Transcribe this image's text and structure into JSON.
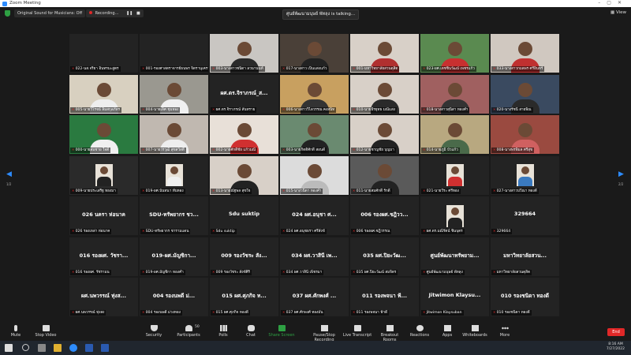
{
  "window": {
    "title": "Zoom Meeting"
  },
  "topbar": {
    "original_sound": "Original Sound for Musicians: Off",
    "recording": "Recording...",
    "speaker": "ศูนย์พัฒนามนุษย์ พัทลุง is talking...",
    "view": "View"
  },
  "participants": [
    {
      "name": "022-นส.จริยา อินทรมะสูตร",
      "big": "",
      "photo": "blank"
    },
    {
      "name": "001-รองศาสตราจารย์ธนพร จิตรานุเคราะห์",
      "big": "",
      "photo": "blank"
    },
    {
      "name": "003-นางสาวชนิดา ลวนานนท์",
      "big": "",
      "photo": "person",
      "bg": "#c9c6c2",
      "shirt": "#2a2a2a"
    },
    {
      "name": "017-นางสาว เป็นแสงแก้ว",
      "big": "",
      "photo": "person",
      "bg": "#4a4038",
      "shirt": "#222"
    },
    {
      "name": "001-มหาวิทยาลัยสวนดุสิต",
      "big": "",
      "photo": "person",
      "bg": "#d8d0c8",
      "shirt": "#b03030"
    },
    {
      "name": "023-ผศ.เดชชินวัฒน์ เพชรแก้ว",
      "big": "",
      "photo": "person",
      "bg": "#5a8a50",
      "shirt": "#c83030"
    },
    {
      "name": "033-นางสาวกมลพร ศรีอินทร์",
      "big": "",
      "photo": "person",
      "bg": "#d0c8c0",
      "shirt": "#c03030"
    },
    {
      "name": "005-นายวิโรจน์ ลิ้มสกุลภัทร",
      "big": "",
      "photo": "person",
      "bg": "#d8d0c0",
      "shirt": "#eeeeee"
    },
    {
      "name": "004-นายเลิศ ชุมทอง",
      "big": "",
      "photo": "person",
      "bg": "#9a9890",
      "shirt": "#f0f0f0"
    },
    {
      "name": "ผศ.ดร.จิราภรณ์ สันทราย",
      "big": "ผศ.ดร.จิราภรณ์_ส...",
      "photo": "name"
    },
    {
      "name": "006-นางสาววิไลวรรณ คงสนิท",
      "big": "",
      "photo": "person",
      "bg": "#c8a060",
      "shirt": "#333"
    },
    {
      "name": "010-นายธีรยุทธ มณีแสง",
      "big": "",
      "photo": "person",
      "bg": "#d8d0c8",
      "shirt": "#2a2a2a"
    },
    {
      "name": "018-นางสาวสุนิสา ทองคำ",
      "big": "",
      "photo": "person",
      "bg": "#a06060",
      "shirt": "#333"
    },
    {
      "name": "020-นางรัชนี สายพิณ",
      "big": "",
      "photo": "person",
      "bg": "#3a4a60",
      "shirt": "#2a2a2a"
    },
    {
      "name": "000-นายสมชาย ใจดี",
      "big": "",
      "photo": "person",
      "bg": "#2a7a40",
      "shirt": "#f0f0f0"
    },
    {
      "name": "007-นายวรวุฒิ สุขสวัสดิ์",
      "big": "",
      "photo": "person",
      "bg": "#c0b8b0",
      "shirt": "#eeeeee"
    },
    {
      "name": "002-นายศักดิ์ชัย แก้วมณี",
      "big": "",
      "photo": "person",
      "bg": "#e8e0d8",
      "shirt": "#d03030"
    },
    {
      "name": "003-นายกิตติศักดิ์ สอนดี",
      "big": "",
      "photo": "person",
      "bg": "#6a8a70",
      "shirt": "#222"
    },
    {
      "name": "012-นายชาญชัย บุญมา",
      "big": "",
      "photo": "person",
      "bg": "#d8d0c8",
      "shirt": "#222"
    },
    {
      "name": "014-นายภูมิ บัวแก้ว",
      "big": "",
      "photo": "person",
      "bg": "#b8a880",
      "shirt": "#4a6a4a"
    },
    {
      "name": "008-นางพรพิมล ศรีสุข",
      "big": "",
      "photo": "person",
      "bg": "#9a4a40",
      "shirt": "#d06060"
    },
    {
      "name": "009-นายประเสริฐ ทองมา",
      "big": "",
      "photo": "portrait",
      "bg": "#2a2a2a",
      "shirt": "#222"
    },
    {
      "name": "019-ผศ.นันทนา ทับทอง",
      "big": "",
      "photo": "portrait",
      "bg": "#232323",
      "shirt": "#f0f0f0"
    },
    {
      "name": "013-นายณัฐพล สุขใจ",
      "big": "",
      "photo": "person",
      "bg": "#d8d0c8",
      "shirt": "#222"
    },
    {
      "name": "015-นางวนิดา ทองคำ",
      "big": "",
      "photo": "person",
      "bg": "#dcdcdc",
      "shirt": "#bbbbbb"
    },
    {
      "name": "011-นายสมศักดิ์ รักดี",
      "big": "",
      "photo": "person",
      "bg": "#5a5a5a",
      "shirt": "#222"
    },
    {
      "name": "021-นายวีระ ศรีทอง",
      "big": "",
      "photo": "portrait",
      "bg": "#232323",
      "shirt": "#d03030"
    },
    {
      "name": "027-นางสาวปวีณา ทองดี",
      "big": "",
      "photo": "portrait",
      "bg": "#232323",
      "shirt": "#3a7ac0"
    },
    {
      "name": "026 รองเหล่า ห่อนาค",
      "big": "026 นครา ห่อนาค",
      "photo": "name"
    },
    {
      "name": "SDU-ทรัพยากร ชารามแดน",
      "big": "SDU-ทรัพยากร ชว...",
      "photo": "name"
    },
    {
      "name": "Sdu suktip",
      "big": "Sdu suktip",
      "photo": "name"
    },
    {
      "name": "024 ผศ.อนุชธรา ศรีสังข์",
      "big": "024 ผศ.อนุชา ศ...",
      "photo": "name"
    },
    {
      "name": "006 รองผศ.ชฎิวรรณ",
      "big": "006 รองผศ.ชฎิวว...",
      "photo": "name"
    },
    {
      "name": "ผศ.ดร.มณีรัตน์ ชินบุตร",
      "big": "",
      "photo": "portrait",
      "bg": "#232323",
      "shirt": "#222"
    },
    {
      "name": "329664",
      "big": "329664",
      "photo": "name"
    },
    {
      "name": "016 รองผศ. รัชรามน",
      "big": "016 รองผศ. วัชรา...",
      "photo": "name"
    },
    {
      "name": "019-ผศ.มัญชิกา ทองคำ",
      "big": "019-ผศ.มัญชิกา...",
      "photo": "name"
    },
    {
      "name": "009 รองวัชระ สังข์ศิริ",
      "big": "009 รองวัชระ สัง...",
      "photo": "name"
    },
    {
      "name": "034 ผศ.วาสินี เพ็ชรมา",
      "big": "034 ผศ.วาสินี เพ...",
      "photo": "name"
    },
    {
      "name": "035 ผศ.ปิยะวัฒน์ สมจิตร",
      "big": "035 ผศ.ปิยะวัฒ...",
      "photo": "name"
    },
    {
      "name": "ศูนย์พัฒนามนุษย์ พัทลุง",
      "big": "ศูนย์พัฒนาทรัพยาม...",
      "photo": "name"
    },
    {
      "name": "มหาวิทยาลัยสวนดุสิต",
      "big": "มหาวิทยาลัยสวน...",
      "photo": "name"
    },
    {
      "name": "ผศ.นพวรรณ์ ทุ่งสง",
      "big": "ผศ.นพวรรณ์ ทุ่งส...",
      "photo": "name"
    },
    {
      "name": "004 รองนพดี ม่วงทอง",
      "big": "004 รองนพดี ม่...",
      "photo": "name"
    },
    {
      "name": "015 ผศ.ศุภกิจ ทองดี",
      "big": "015 ผศ.ศุภกิจ ท...",
      "photo": "name"
    },
    {
      "name": "037 ผศ.ศักพงศ์ ทองมั่น",
      "big": "037 ผศ.ศักพงศ์ ...",
      "photo": "name"
    },
    {
      "name": "011 รองพจนา ฟ้าดี",
      "big": "011 รองพจนา ฟ้...",
      "photo": "name"
    },
    {
      "name": "Jitwimon Klaysuban",
      "big": "Jitwimon Klaysu...",
      "photo": "name"
    },
    {
      "name": "010 รองชนิดา ทองดี",
      "big": "010 รองชนิดา ทองดี",
      "photo": "name"
    }
  ],
  "pages": {
    "left": "1/2",
    "right": "2/2"
  },
  "toolbar": {
    "mute": "Mute",
    "video": "Stop Video",
    "security": "Security",
    "participants": "Participants",
    "participants_count": "50",
    "polls": "Polls",
    "chat": "Chat",
    "share": "Share Screen",
    "record": "Pause/Stop Recording",
    "transcript": "Live Transcript",
    "breakout": "Breakout Rooms",
    "reactions": "Reactions",
    "apps": "Apps",
    "whiteboards": "Whiteboards",
    "more": "More",
    "end": "End"
  },
  "taskbar": {
    "time": "8:16 AM",
    "date": "7/27/2022"
  }
}
